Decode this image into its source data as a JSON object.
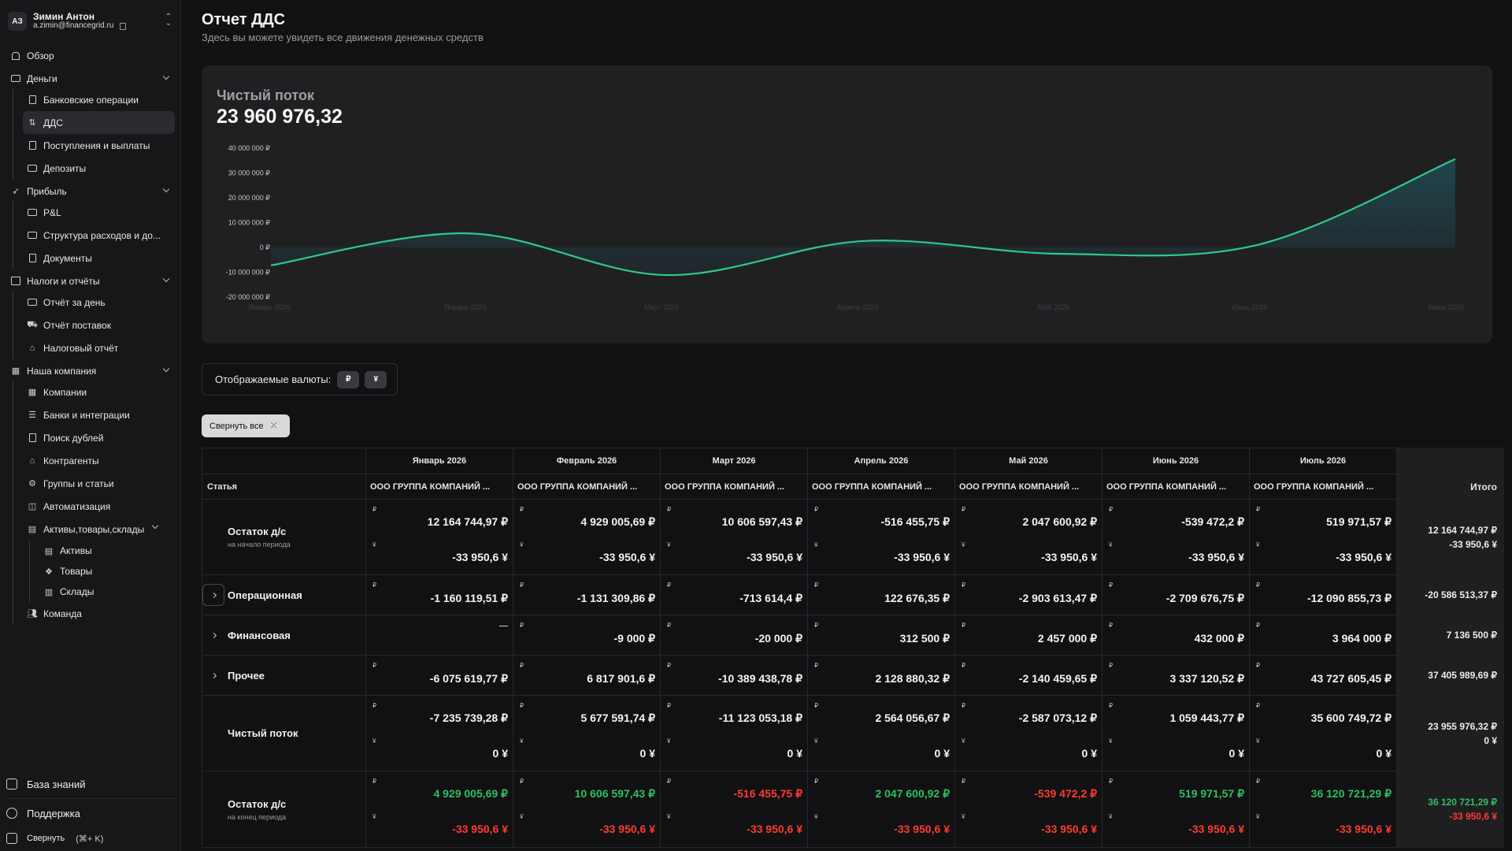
{
  "user": {
    "initials": "АЗ",
    "name": "Зимин Антон",
    "email": "a.zimin@financegrid.ru"
  },
  "nav": {
    "overview": "Обзор",
    "money": {
      "label": "Деньги",
      "items": [
        "Банковские операции",
        "ДДС",
        "Поступления и выплаты",
        "Депозиты"
      ]
    },
    "profit": {
      "label": "Прибыль",
      "items": [
        "P&L",
        "Структура расходов и до...",
        "Документы"
      ]
    },
    "taxes": {
      "label": "Налоги и отчёты",
      "items": [
        "Отчёт за день",
        "Отчёт поставок",
        "Налоговый отчёт"
      ]
    },
    "company": {
      "label": "Наша компания",
      "items": [
        "Компании",
        "Банки и интеграции",
        "Поиск дублей",
        "Контрагенты",
        "Группы и статьи",
        "Автоматизация"
      ],
      "assets": {
        "label": "Активы,товары,склады",
        "items": [
          "Активы",
          "Товары",
          "Склады"
        ]
      },
      "team": "Команда"
    }
  },
  "bottom": {
    "knowledge": "База знаний",
    "support": "Поддержка",
    "collapse": "Свернуть",
    "shortcut": "(⌘+ K)"
  },
  "page": {
    "title": "Отчет ДДС",
    "subtitle": "Здесь вы можете увидеть все движения денежных средств"
  },
  "chart_data": {
    "type": "area",
    "title": "Чистый поток",
    "headline_value": "23 960 976,32",
    "y_ticks": [
      "40 000 000 ₽",
      "30 000 000 ₽",
      "20 000 000 ₽",
      "10 000 000 ₽",
      "0 ₽",
      "-10 000 000 ₽",
      "-20 000 000 ₽"
    ],
    "x_ticks": [
      "Январь 2026",
      "Январь 2026",
      "Март 2026",
      "Апрель 2026",
      "Май 2026",
      "Июнь 2026",
      "Июль 2026"
    ],
    "ylim": [
      -20000000,
      40000000
    ],
    "series": [
      {
        "points": [
          [
            0,
            -7235739
          ],
          [
            1,
            5677592
          ],
          [
            2,
            -11123053
          ],
          [
            3,
            2564057
          ],
          [
            4,
            -2587073
          ],
          [
            5,
            1059444
          ],
          [
            6,
            35600750
          ]
        ]
      }
    ],
    "colors": {
      "line": "#2ec98a",
      "fill_top": "#1f4a52"
    }
  },
  "currencies": {
    "label": "Отображаемые валюты:",
    "rub": "₽",
    "cny": "¥"
  },
  "collapse_all": "Свернуть все",
  "table": {
    "article_header": "Статья",
    "total_header": "Итого",
    "months": [
      "Январь 2026",
      "Февраль 2026",
      "Март 2026",
      "Апрель 2026",
      "Май 2026",
      "Июнь 2026",
      "Июль 2026"
    ],
    "company": "ООО ГРУППА КОМПАНИЙ ...",
    "rub_sym": "₽",
    "cny_sym": "¥",
    "rows": [
      {
        "label": "Остаток д/с",
        "note": "на начало периода",
        "rub": [
          "12 164 744,97 ₽",
          "4 929 005,69 ₽",
          "10 606 597,43 ₽",
          "-516 455,75 ₽",
          "2 047 600,92 ₽",
          "-539 472,2 ₽",
          "519 971,57 ₽"
        ],
        "cny": [
          "-33 950,6 ¥",
          "-33 950,6 ¥",
          "-33 950,6 ¥",
          "-33 950,6 ¥",
          "-33 950,6 ¥",
          "-33 950,6 ¥",
          "-33 950,6 ¥"
        ],
        "total": [
          "12 164 744,97 ₽",
          "-33 950,6 ¥"
        ]
      },
      {
        "label": "Операционная",
        "rub": [
          "-1 160 119,51 ₽",
          "-1 131 309,86 ₽",
          "-713 614,4 ₽",
          "122 676,35 ₽",
          "-2 903 613,47 ₽",
          "-2 709 676,75 ₽",
          "-12 090 855,73 ₽"
        ],
        "total": [
          "-20 586 513,37 ₽"
        ]
      },
      {
        "label": "Финансовая",
        "rub": [
          "",
          "-9 000 ₽",
          "-20 000 ₽",
          "312 500 ₽",
          "2 457 000 ₽",
          "432 000 ₽",
          "3 964 000 ₽"
        ],
        "total": [
          "7 136 500 ₽"
        ]
      },
      {
        "label": "Прочее",
        "rub": [
          "-6 075 619,77 ₽",
          "6 817 901,6 ₽",
          "-10 389 438,78 ₽",
          "2 128 880,32 ₽",
          "-2 140 459,65 ₽",
          "3 337 120,52 ₽",
          "43 727 605,45 ₽"
        ],
        "total": [
          "37 405 989,69 ₽"
        ]
      },
      {
        "label": "Чистый поток",
        "rub": [
          "-7 235 739,28 ₽",
          "5 677 591,74 ₽",
          "-11 123 053,18 ₽",
          "2 564 056,67 ₽",
          "-2 587 073,12 ₽",
          "1 059 443,77 ₽",
          "35 600 749,72 ₽"
        ],
        "cny": [
          "0 ¥",
          "0 ¥",
          "0 ¥",
          "0 ¥",
          "0 ¥",
          "0 ¥",
          "0 ¥"
        ],
        "total": [
          "23 955 976,32 ₽",
          "0 ¥"
        ]
      },
      {
        "label": "Остаток д/с",
        "note": "на конец периода",
        "rub": [
          "4 929 005,69 ₽",
          "10 606 597,43 ₽",
          "-516 455,75 ₽",
          "2 047 600,92 ₽",
          "-539 472,2 ₽",
          "519 971,57 ₽",
          "36 120 721,29 ₽"
        ],
        "cny": [
          "-33 950,6 ¥",
          "-33 950,6 ¥",
          "-33 950,6 ¥",
          "-33 950,6 ¥",
          "-33 950,6 ¥",
          "-33 950,6 ¥",
          "-33 950,6 ¥"
        ],
        "total": [
          "36 120 721,29 ₽",
          "-33 950,6 ¥"
        ]
      }
    ]
  }
}
